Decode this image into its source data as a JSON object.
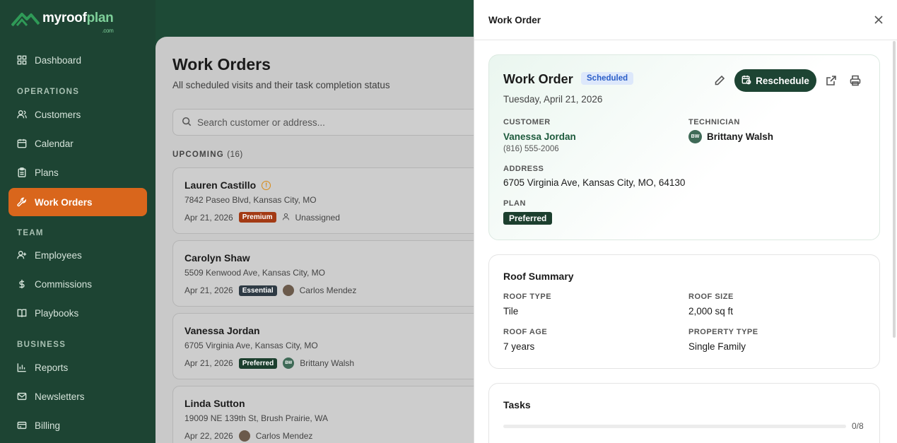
{
  "brand": {
    "name_part1": "myroof",
    "name_part2": "plan",
    "suffix": ".com",
    "accent": "#7ed09a"
  },
  "sidebar": {
    "items": [
      {
        "label": "Dashboard",
        "icon": "grid-icon"
      },
      {
        "label": "Customers",
        "icon": "users-icon"
      },
      {
        "label": "Calendar",
        "icon": "calendar-icon"
      },
      {
        "label": "Plans",
        "icon": "clipboard-icon"
      },
      {
        "label": "Work Orders",
        "icon": "wrench-icon",
        "active": true
      },
      {
        "label": "Employees",
        "icon": "user-plus-icon"
      },
      {
        "label": "Commissions",
        "icon": "dollar-icon"
      },
      {
        "label": "Playbooks",
        "icon": "book-icon"
      },
      {
        "label": "Reports",
        "icon": "bar-chart-icon"
      },
      {
        "label": "Newsletters",
        "icon": "mail-icon"
      },
      {
        "label": "Billing",
        "icon": "credit-card-icon"
      }
    ],
    "sections": {
      "operations": "OPERATIONS",
      "team": "TEAM",
      "business": "BUSINESS"
    },
    "active_color": "#d9661c"
  },
  "main": {
    "title": "Work Orders",
    "subtitle": "All scheduled visits and their task completion status",
    "search_placeholder": "Search customer or address...",
    "upcoming_label": "UPCOMING",
    "upcoming_count": "(16)",
    "cards": [
      {
        "name": "Lauren Castillo",
        "address": "7842 Paseo Blvd, Kansas City, MO",
        "date": "Apr 21, 2026",
        "plan": "Premium",
        "assignee": "Unassigned"
      },
      {
        "name": "Carolyn Shaw",
        "address": "5509 Kenwood Ave, Kansas City, MO",
        "date": "Apr 21, 2026",
        "plan": "Essential",
        "assignee": "Carlos Mendez"
      },
      {
        "name": "Vanessa Jordan",
        "address": "6705 Virginia Ave, Kansas City, MO",
        "date": "Apr 21, 2026",
        "plan": "Preferred",
        "assignee": "Brittany Walsh",
        "assignee_initials": "BW"
      },
      {
        "name": "Linda Sutton",
        "address": "19009 NE 139th St, Brush Prairie, WA",
        "date": "Apr 22, 2026",
        "assignee": "Carlos Mendez"
      }
    ]
  },
  "drawer": {
    "header_title": "Work Order",
    "hero": {
      "title": "Work Order",
      "status": "Scheduled",
      "date": "Tuesday, April 21, 2026",
      "reschedule_label": "Reschedule",
      "customer_label": "CUSTOMER",
      "customer_name": "Vanessa Jordan",
      "customer_phone": "(816) 555-2006",
      "technician_label": "TECHNICIAN",
      "technician_name": "Brittany Walsh",
      "technician_initials": "BW",
      "address_label": "ADDRESS",
      "address": "6705 Virginia Ave, Kansas City, MO, 64130",
      "plan_label": "PLAN",
      "plan": "Preferred"
    },
    "roof": {
      "title": "Roof Summary",
      "roof_type_label": "ROOF TYPE",
      "roof_type": "Tile",
      "roof_size_label": "ROOF SIZE",
      "roof_size": "2,000 sq ft",
      "roof_age_label": "ROOF AGE",
      "roof_age": "7 years",
      "property_type_label": "PROPERTY TYPE",
      "property_type": "Single Family"
    },
    "tasks": {
      "title": "Tasks",
      "progress_text": "0/8",
      "progress_fraction": 0
    }
  }
}
